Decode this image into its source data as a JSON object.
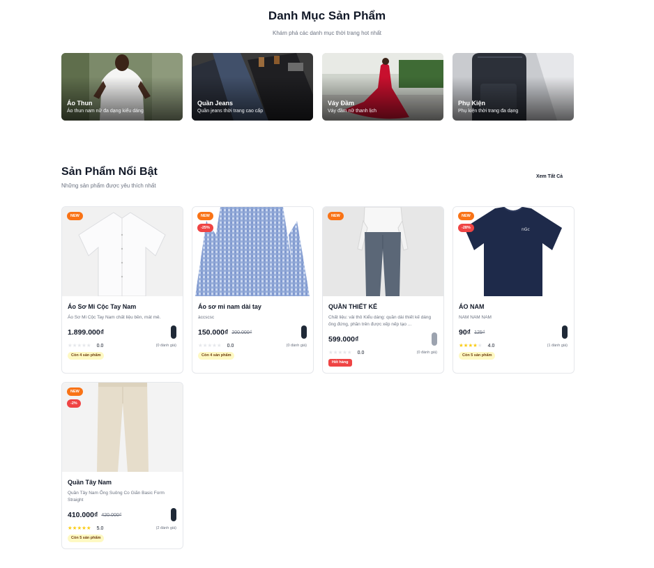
{
  "categories_section": {
    "title": "Danh Mục Sản Phẩm",
    "subtitle": "Khám phá các danh mục thời trang hot nhất"
  },
  "categories": [
    {
      "name": "Áo Thun",
      "description": "Áo thun nam nữ đa dạng kiểu dáng"
    },
    {
      "name": "Quần Jeans",
      "description": "Quần jeans thời trang cao cấp"
    },
    {
      "name": "Váy Đầm",
      "description": "Váy đầm nữ thanh lịch"
    },
    {
      "name": "Phụ Kiện",
      "description": "Phụ kiện thời trang đa dạng"
    }
  ],
  "featured": {
    "title": "Sản Phẩm Nổi Bật",
    "subtitle": "Những sản phẩm được yêu thích nhất",
    "view_all": "Xem Tất Cả"
  },
  "products": [
    {
      "name": "Áo Sơ Mi Cộc Tay Nam",
      "description": "Áo Sơ Mi Cộc Tay Nam chất liệu bền, mát mẻ.",
      "price": "1.899.000₫",
      "old_price": "",
      "badge_new": "NEW",
      "badge_discount": "",
      "rating": "0.0",
      "stars": 0,
      "review_count": "(0 đánh giá)",
      "stock": "Còn 4 sản phẩm",
      "status": ""
    },
    {
      "name": "Áo sơ mi nam dài tay",
      "description": "àccscsc",
      "price": "150.000₫",
      "old_price": "200.000₫",
      "badge_new": "NEW",
      "badge_discount": "-25%",
      "rating": "0.0",
      "stars": 0,
      "review_count": "(0 đánh giá)",
      "stock": "Còn 4 sản phẩm",
      "status": ""
    },
    {
      "name": "QUẦN THIẾT KẾ",
      "description": "Chất liệu: vải thô Kiểu dáng: quần dài thiết kế dáng ống đứng, phần trên được xếp nếp tạo ...",
      "price": "599.000₫",
      "old_price": "",
      "badge_new": "NEW",
      "badge_discount": "",
      "rating": "0.0",
      "stars": 0,
      "review_count": "(0 đánh giá)",
      "stock": "",
      "status": "Hết hàng"
    },
    {
      "name": "ÁO NAM",
      "description": "NAM NAM NAM",
      "price": "90₫",
      "old_price": "125₫",
      "badge_new": "NEW",
      "badge_discount": "-28%",
      "rating": "4.0",
      "stars": 4,
      "review_count": "(1 đánh giá)",
      "stock": "Còn 5 sản phẩm",
      "status": ""
    },
    {
      "name": "Quần Tây Nam",
      "description": "Quần Tây Nam Ống Suông Co Giãn Basic Form Straight",
      "price": "410.000₫",
      "old_price": "420.000₫",
      "badge_new": "NEW",
      "badge_discount": "-2%",
      "rating": "5.0",
      "stars": 5,
      "review_count": "(2 đánh giá)",
      "stock": "Còn 5 sản phẩm",
      "status": ""
    }
  ],
  "colors": {
    "badge_new": "#f97316",
    "badge_discount": "#ef4444",
    "star": "#facc15",
    "stock_badge": "#fef9c3",
    "cart_button": "#1f2937"
  }
}
